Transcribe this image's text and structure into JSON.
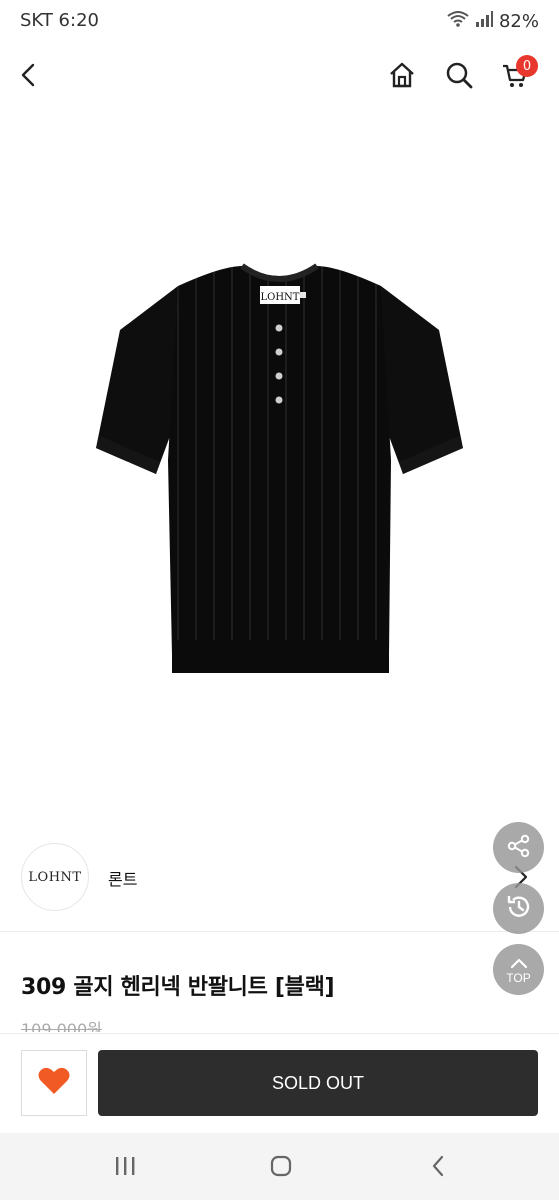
{
  "status_bar": {
    "carrier_time": "SKT 6:20",
    "battery": "82%"
  },
  "header": {
    "cart_count": "0"
  },
  "product_image": {
    "tag_text": "LOHNT"
  },
  "brand": {
    "logo_text": "LOHNT",
    "name": "론트"
  },
  "fab": {
    "top_label": "TOP"
  },
  "product": {
    "title": "309 골지 헨리넥 반팔니트 [블랙]",
    "price": "109,000원"
  },
  "actions": {
    "soldout_label": "SOLD OUT"
  },
  "colors": {
    "badge": "#e8372c",
    "heart": "#f15a24",
    "button_dark": "#2d2d2d"
  }
}
